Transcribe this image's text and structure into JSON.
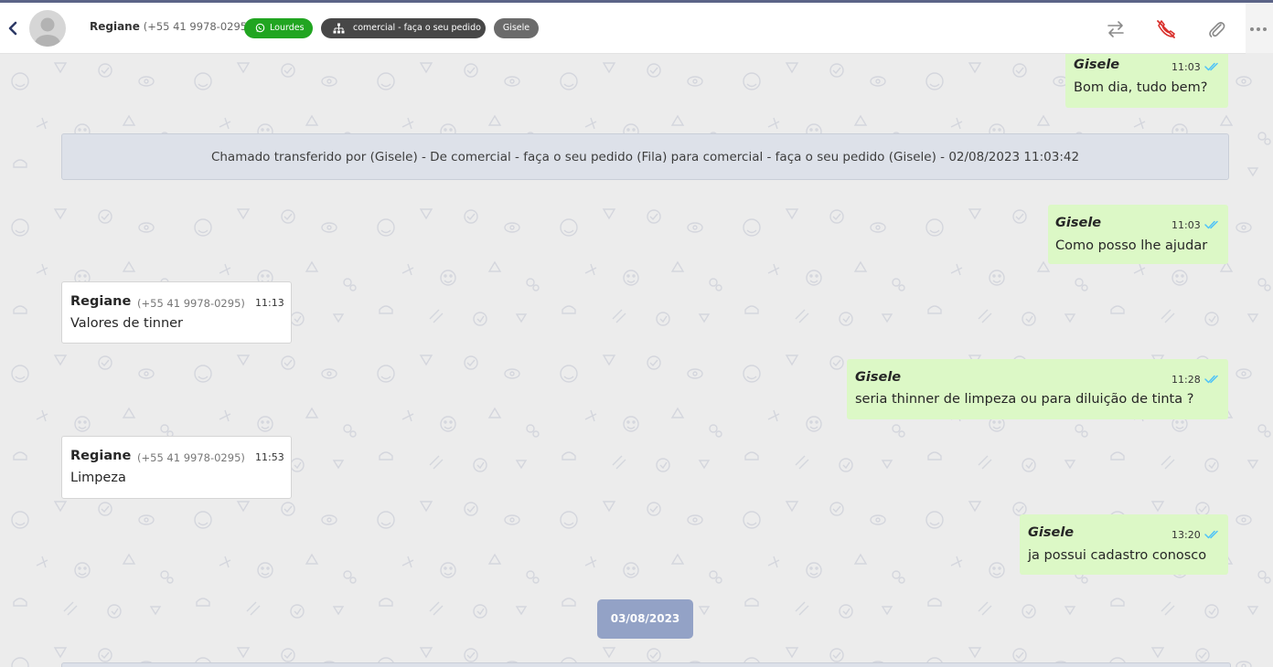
{
  "header": {
    "contact_name": "Regiane",
    "contact_phone": "(+55 41 9978-0295)",
    "whatsapp_badge": "Lourdes",
    "queue_badge": "comercial - faça o seu pedido",
    "agent_badge": "Gisele"
  },
  "messages": {
    "m1": {
      "sender": "Gisele",
      "time": "11:03",
      "text": "Bom dia, tudo bem?"
    },
    "system": "Chamado transferido por (Gisele) - De comercial - faça o seu pedido (Fila) para comercial - faça o seu pedido (Gisele) - 02/08/2023 11:03:42",
    "m2": {
      "sender": "Gisele",
      "time": "11:03",
      "text": "Como posso lhe ajudar"
    },
    "m3": {
      "sender": "Regiane",
      "phone": "(+55 41 9978-0295)",
      "time": "11:13",
      "text": "Valores de tinner"
    },
    "m4": {
      "sender": "Gisele",
      "time": "11:28",
      "text": "seria thinner de limpeza ou para diluição de tinta ?"
    },
    "m5": {
      "sender": "Regiane",
      "phone": "(+55 41 9978-0295)",
      "time": "11:53",
      "text": "Limpeza"
    },
    "m6": {
      "sender": "Gisele",
      "time": "13:20",
      "text": "ja possui cadastro conosco"
    },
    "date_divider": "03/08/2023"
  },
  "colors": {
    "outgoing_bubble": "#dcf8c6",
    "incoming_bubble": "#ffffff",
    "read_check": "#4fc3f7",
    "whatsapp_green": "#21a521",
    "hangup_red": "#d9302c",
    "date_chip": "#93a2c6"
  },
  "icons": [
    "chevron-left-icon",
    "avatar-icon",
    "whatsapp-icon",
    "sitemap-icon",
    "transfer-icon",
    "hangup-icon",
    "paperclip-icon",
    "more-icon",
    "double-check-icon"
  ]
}
